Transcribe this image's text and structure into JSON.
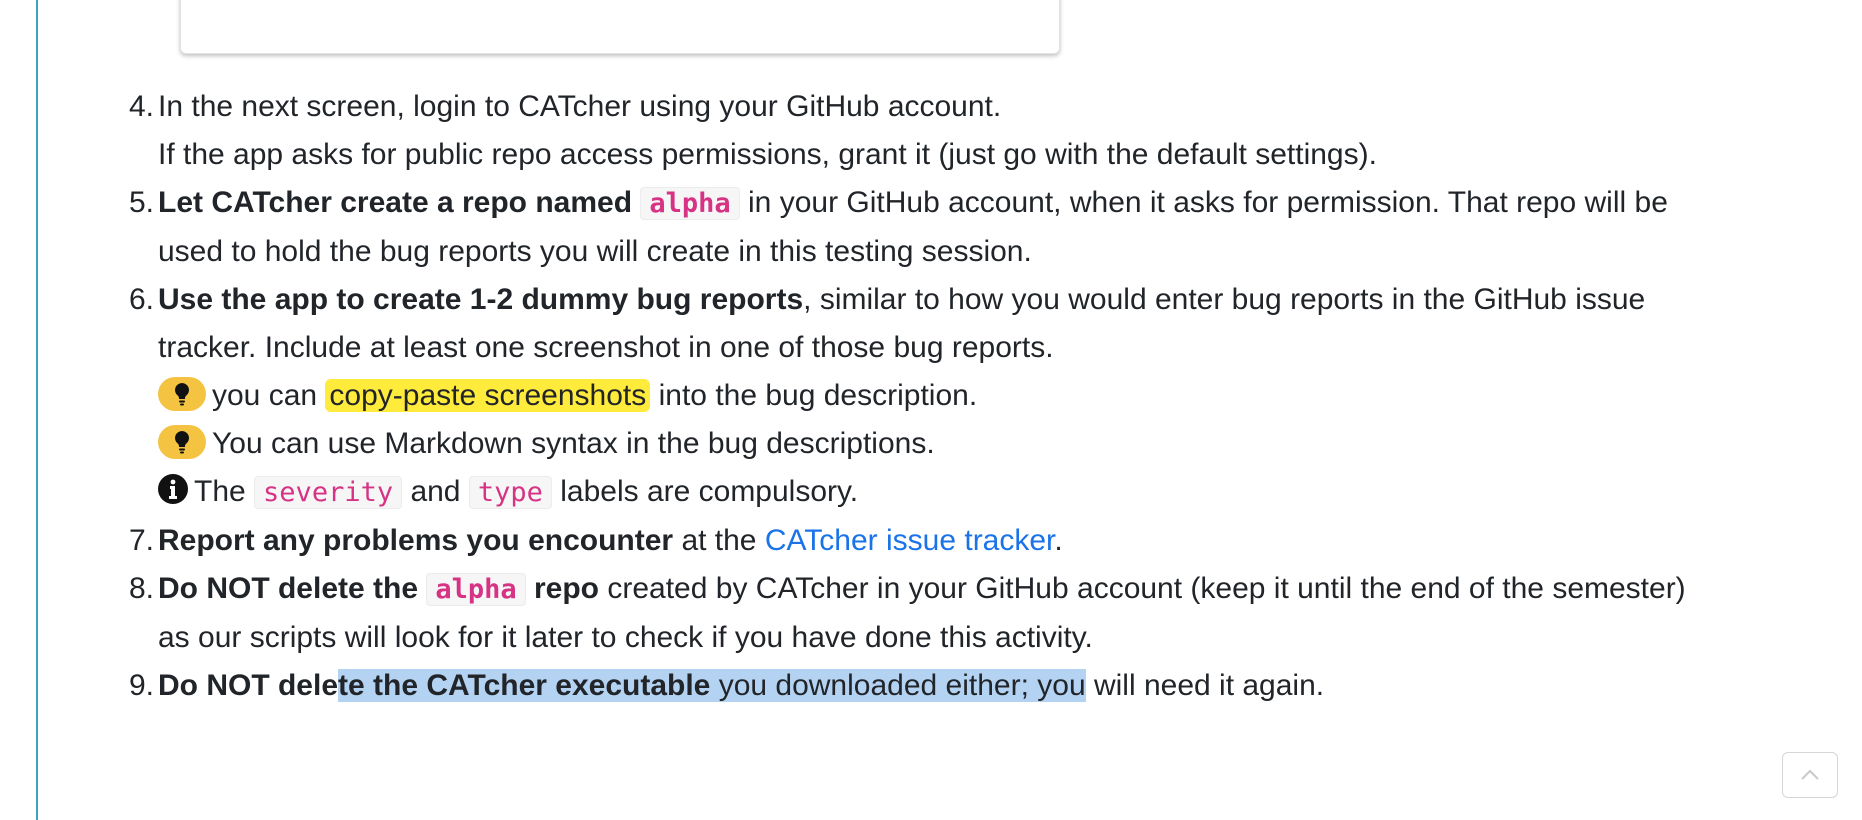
{
  "steps": [
    {
      "num": "4.",
      "line1": "In the next screen, login to CATcher using your GitHub account.",
      "line2": "If the app asks for public repo access permissions, grant it (just go with the default settings)."
    },
    {
      "num": "5.",
      "bold": "Let CATcher create a repo named",
      "code": "alpha",
      "rest1": "in your GitHub account, when it asks for permission. That repo will be",
      "line2": "used to hold the bug reports you will create in this testing session."
    },
    {
      "num": "6.",
      "bold": "Use the app to create 1-2 dummy bug reports",
      "rest1": ", similar to how you would enter bug reports in the GitHub issue",
      "line2": "tracker. Include at least one screenshot in one of those bug reports.",
      "tip1_pre": "you can",
      "tip1_highlight": "copy-paste screenshots",
      "tip1_post": "into the bug description.",
      "tip2": "You can use Markdown syntax in the bug descriptions.",
      "info_pre": "The",
      "info_code1": "severity",
      "info_mid": "and",
      "info_code2": "type",
      "info_post": "labels are compulsory."
    },
    {
      "num": "7.",
      "bold": "Report any problems you encounter",
      "mid": "at the",
      "link": "CATcher issue tracker",
      "end": "."
    },
    {
      "num": "8.",
      "bold_pre": "Do NOT delete the",
      "code": "alpha",
      "bold_post": "repo",
      "rest1": "created by CATcher in your GitHub account (keep it until the end of the semester)",
      "line2": "as our scripts will look for it later to check if you have done this activity."
    },
    {
      "num": "9.",
      "bold_a": "Do NOT dele",
      "bold_b": "te the CATcher executable",
      "sel_normal": " you downloaded either; you",
      "rest": " will need it again."
    }
  ],
  "icons": {
    "tip": "lightbulb-icon",
    "info": "info-circle-icon",
    "scroll_top": "chevron-up-icon"
  }
}
